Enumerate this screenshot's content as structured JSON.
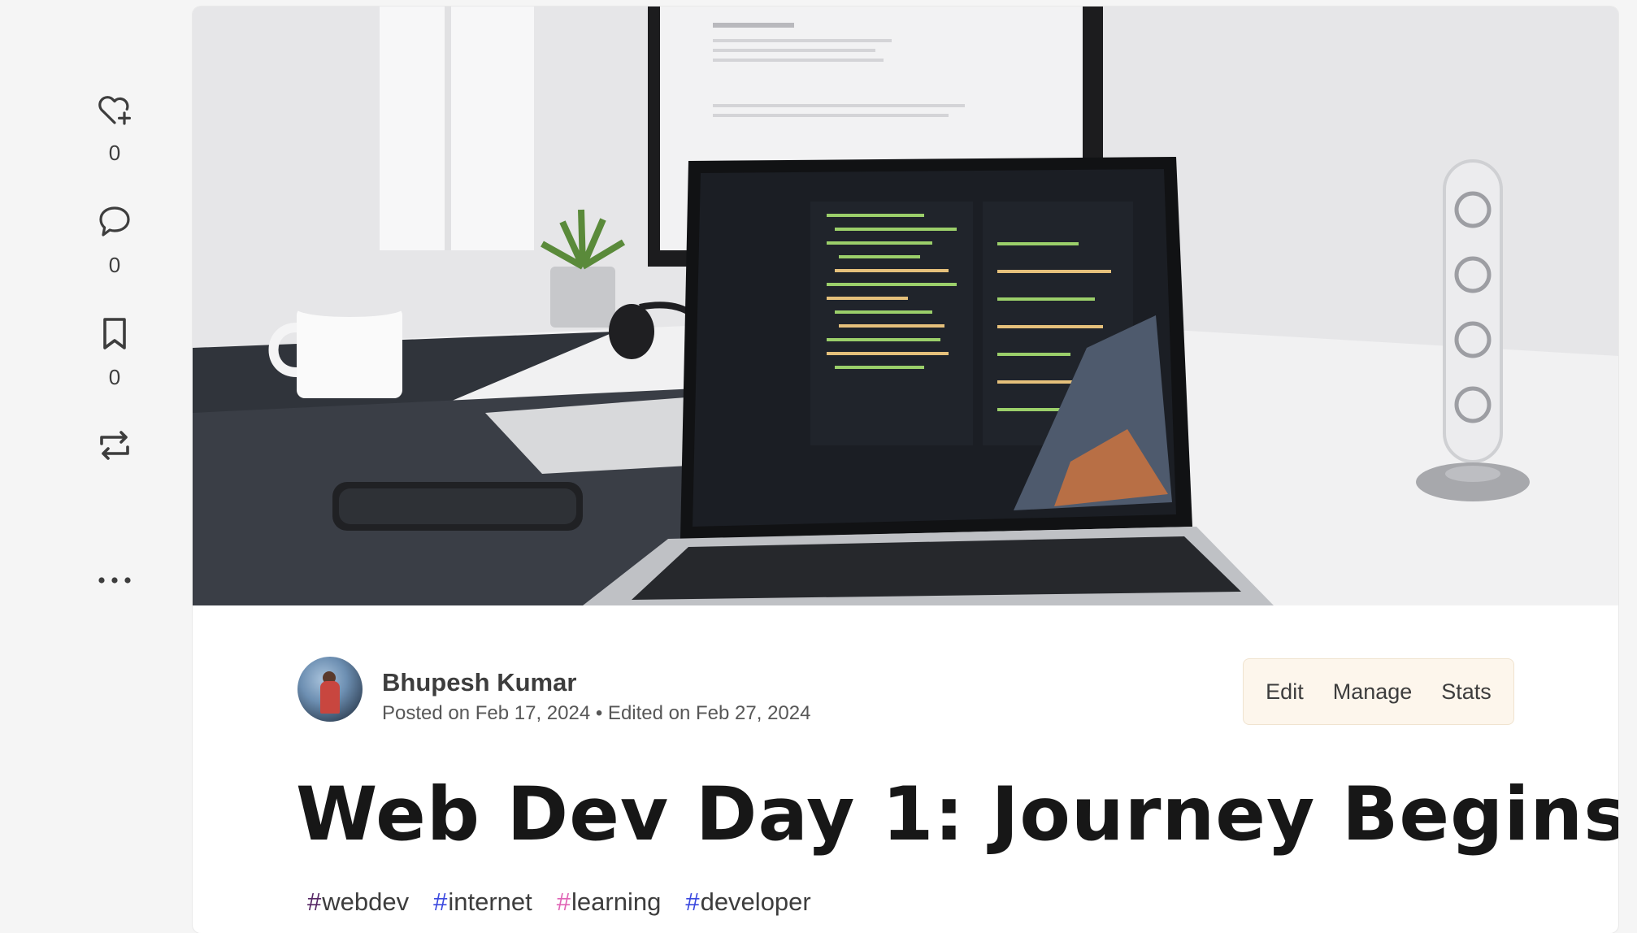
{
  "reactions": {
    "like": {
      "icon": "heart-plus-icon",
      "count": "0"
    },
    "comments": {
      "icon": "comment-icon",
      "count": "0"
    },
    "bookmark": {
      "icon": "bookmark-icon",
      "count": "0"
    },
    "share": {
      "icon": "repost-icon"
    },
    "more": {
      "icon": "more-horizontal-icon"
    }
  },
  "article": {
    "cover_image": "desk-laptop-code-photo",
    "author": {
      "name": "Bhupesh Kumar",
      "avatar": "author-avatar",
      "dates": "Posted on Feb 17, 2024 • Edited on Feb 27, 2024"
    },
    "actions": {
      "edit": "Edit",
      "manage": "Manage",
      "stats": "Stats"
    },
    "title": "Web Dev Day 1: Journey Begins",
    "tags": [
      {
        "hash": "#",
        "name": "webdev",
        "color": "#562765"
      },
      {
        "hash": "#",
        "name": "internet",
        "color": "#3b49df"
      },
      {
        "hash": "#",
        "name": "learning",
        "color": "#e065b6"
      },
      {
        "hash": "#",
        "name": "developer",
        "color": "#3b49df"
      }
    ]
  },
  "colors": {
    "page_bg": "#f5f5f5",
    "card_bg": "#ffffff",
    "actions_bg": "#fdf6ec"
  }
}
